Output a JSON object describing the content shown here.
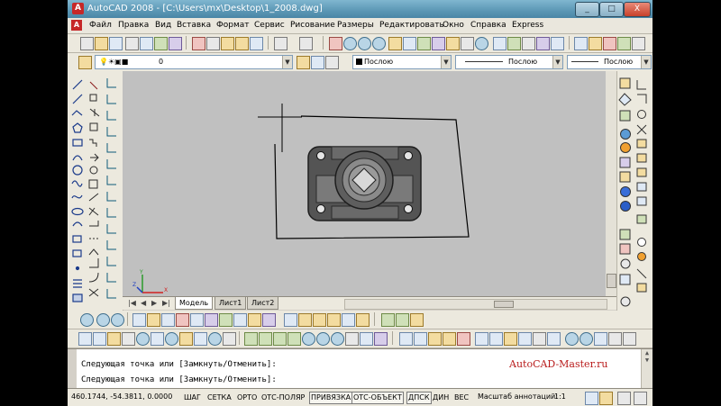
{
  "window": {
    "title": "AutoCAD 2008 - [C:\\Users\\mx\\Desktop\\1_2008.dwg]",
    "minimize": "_",
    "maximize": "□",
    "close": "X"
  },
  "menu": {
    "items": [
      "Файл",
      "Правка",
      "Вид",
      "Вставка",
      "Формат",
      "Сервис",
      "Рисование",
      "Размеры",
      "Редактировать",
      "Окно",
      "Справка",
      "Express"
    ]
  },
  "layers": {
    "current_layer": "0"
  },
  "properties": {
    "color": "Послою",
    "linetype": "Послою",
    "lineweight": "Послою"
  },
  "tabs": {
    "items": [
      "Модель",
      "Лист1",
      "Лист2"
    ],
    "active": "Модель"
  },
  "command": {
    "line1": "Следующая точка или [Замкнуть/Отменить]:",
    "line2": "Следующая точка или [Замкнуть/Отменить]:",
    "watermark": "AutoCAD-Master.ru"
  },
  "status": {
    "coords": "460.1744, -54.3811, 0.0000",
    "toggles": [
      "ШАГ",
      "СЕТКА",
      "ОРТО",
      "ОТС-ПОЛЯР",
      "ПРИВЯЗКА",
      "ОТС-ОБЪЕКТ",
      "ДПСК",
      "ДИН",
      "ВЕС"
    ],
    "annotation_label": "Масштаб аннотаций:",
    "annotation_value": "1:1"
  },
  "colors": {
    "canvas": "#c0c0c0",
    "part_body": "#545454",
    "part_highlight": "#9a9a9a"
  }
}
